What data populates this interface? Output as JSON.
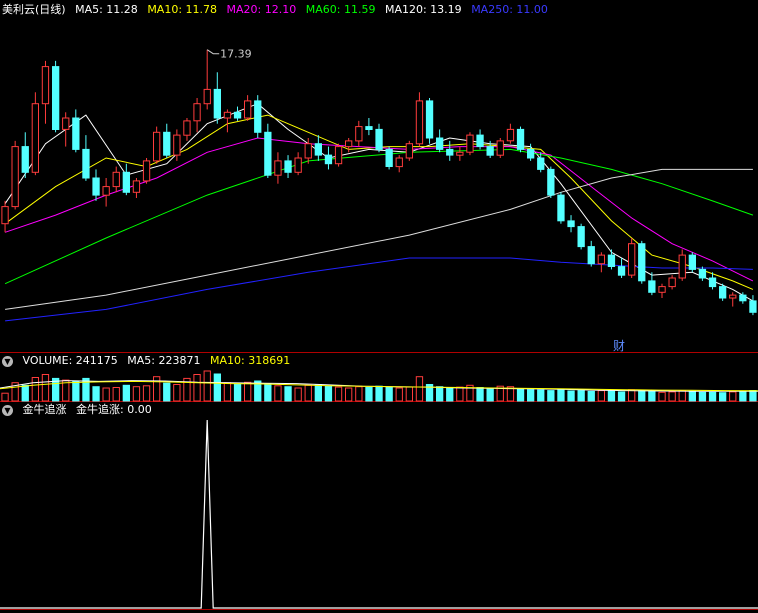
{
  "colors": {
    "up": "#ff3c3c",
    "down": "#54ffff",
    "panel_line": "#b00000",
    "ma5": "#ffffff",
    "ma10": "#ffff00",
    "ma20": "#ff00ff",
    "ma60": "#00ff00",
    "ma120": "#dddddd",
    "ma250": "#2222ff",
    "indicator": "#ffffff"
  },
  "main_header": {
    "title": "美利云(日线)",
    "ma5_label": "MA5: 11.28",
    "ma10_label": "MA10: 11.78",
    "ma20_label": "MA20: 12.10",
    "ma60_label": "MA60: 11.59",
    "ma120_label": "MA120: 13.19",
    "ma250_label": "MA250: 11.00"
  },
  "volume_header": {
    "label": "VOLUME: 241175",
    "ma5_label": "MA5: 223871",
    "ma10_label": "MA10: 318691"
  },
  "indicator_header": {
    "name": "金牛追涨",
    "value_label": "金牛追涨: 0.00"
  },
  "annotations": {
    "high_label": "17.39",
    "finance_marker": "财"
  },
  "chart_data": [
    {
      "type": "candlestick",
      "name": "price",
      "high_marker": 17.39,
      "y_range_estimate": [
        8.0,
        18.5
      ],
      "candles": [
        [
          11.3,
          12.1,
          11.0,
          11.9
        ],
        [
          11.9,
          14.2,
          11.8,
          14.0
        ],
        [
          14.0,
          14.5,
          12.9,
          13.1
        ],
        [
          13.1,
          15.9,
          13.0,
          15.5
        ],
        [
          15.5,
          17.0,
          14.8,
          16.8
        ],
        [
          16.8,
          17.0,
          14.5,
          14.6
        ],
        [
          14.6,
          15.2,
          14.0,
          15.0
        ],
        [
          15.0,
          15.3,
          13.8,
          13.9
        ],
        [
          13.9,
          14.4,
          12.8,
          12.9
        ],
        [
          12.9,
          13.2,
          12.1,
          12.3
        ],
        [
          12.3,
          12.9,
          11.9,
          12.6
        ],
        [
          12.6,
          13.3,
          12.4,
          13.1
        ],
        [
          13.1,
          13.4,
          12.3,
          12.4
        ],
        [
          12.4,
          12.9,
          12.2,
          12.8
        ],
        [
          12.8,
          13.6,
          12.7,
          13.5
        ],
        [
          13.5,
          14.7,
          13.4,
          14.5
        ],
        [
          14.5,
          14.8,
          13.6,
          13.7
        ],
        [
          13.7,
          14.6,
          13.5,
          14.4
        ],
        [
          14.4,
          15.0,
          14.2,
          14.9
        ],
        [
          14.9,
          15.7,
          14.5,
          15.5
        ],
        [
          15.5,
          17.39,
          15.3,
          16.0
        ],
        [
          16.0,
          16.6,
          14.8,
          15.0
        ],
        [
          15.0,
          15.3,
          14.5,
          15.2
        ],
        [
          15.2,
          15.4,
          14.9,
          15.0
        ],
        [
          15.0,
          15.8,
          14.9,
          15.6
        ],
        [
          15.6,
          15.8,
          14.3,
          14.5
        ],
        [
          14.5,
          14.8,
          12.9,
          13.0
        ],
        [
          13.0,
          13.8,
          12.7,
          13.5
        ],
        [
          13.5,
          13.7,
          12.9,
          13.1
        ],
        [
          13.1,
          13.8,
          13.0,
          13.6
        ],
        [
          13.6,
          14.3,
          13.4,
          14.1
        ],
        [
          14.1,
          14.4,
          13.5,
          13.7
        ],
        [
          13.7,
          14.0,
          13.2,
          13.4
        ],
        [
          13.4,
          14.1,
          13.3,
          14.0
        ],
        [
          14.0,
          14.3,
          13.8,
          14.2
        ],
        [
          14.2,
          14.9,
          14.0,
          14.7
        ],
        [
          14.7,
          15.0,
          14.4,
          14.6
        ],
        [
          14.6,
          14.8,
          13.8,
          13.9
        ],
        [
          13.9,
          14.0,
          13.2,
          13.3
        ],
        [
          13.3,
          13.7,
          13.1,
          13.6
        ],
        [
          13.6,
          14.2,
          13.5,
          14.1
        ],
        [
          14.1,
          15.9,
          14.0,
          15.6
        ],
        [
          15.6,
          15.7,
          14.1,
          14.3
        ],
        [
          14.3,
          14.6,
          13.8,
          13.9
        ],
        [
          13.9,
          14.2,
          13.5,
          13.7
        ],
        [
          13.7,
          14.0,
          13.5,
          13.8
        ],
        [
          13.8,
          14.5,
          13.7,
          14.4
        ],
        [
          14.4,
          14.6,
          13.9,
          14.0
        ],
        [
          14.0,
          14.2,
          13.6,
          13.7
        ],
        [
          13.7,
          14.3,
          13.6,
          14.2
        ],
        [
          14.2,
          14.8,
          14.1,
          14.6
        ],
        [
          14.6,
          14.7,
          13.8,
          13.9
        ],
        [
          13.9,
          14.1,
          13.5,
          13.6
        ],
        [
          13.6,
          13.8,
          13.1,
          13.2
        ],
        [
          13.2,
          13.3,
          12.2,
          12.3
        ],
        [
          12.3,
          12.4,
          11.3,
          11.4
        ],
        [
          11.4,
          11.6,
          11.0,
          11.2
        ],
        [
          11.2,
          11.3,
          10.4,
          10.5
        ],
        [
          10.5,
          10.7,
          9.8,
          9.9
        ],
        [
          9.9,
          10.3,
          9.6,
          10.2
        ],
        [
          10.2,
          10.4,
          9.7,
          9.8
        ],
        [
          9.8,
          10.1,
          9.4,
          9.5
        ],
        [
          9.5,
          10.8,
          9.4,
          10.6
        ],
        [
          10.6,
          10.7,
          9.2,
          9.3
        ],
        [
          9.3,
          9.6,
          8.8,
          8.9
        ],
        [
          8.9,
          9.2,
          8.7,
          9.1
        ],
        [
          9.1,
          9.5,
          9.0,
          9.4
        ],
        [
          9.4,
          10.4,
          9.3,
          10.2
        ],
        [
          10.2,
          10.3,
          9.6,
          9.7
        ],
        [
          9.7,
          9.8,
          9.3,
          9.4
        ],
        [
          9.4,
          9.6,
          9.0,
          9.1
        ],
        [
          9.1,
          9.2,
          8.6,
          8.7
        ],
        [
          8.7,
          8.9,
          8.4,
          8.8
        ],
        [
          8.8,
          8.9,
          8.5,
          8.6
        ],
        [
          8.6,
          8.8,
          8.1,
          8.2
        ]
      ],
      "moving_averages": [
        {
          "name": "MA5",
          "color": "#ffffff",
          "points": [
            [
              0,
              12.0
            ],
            [
              4,
              14.1
            ],
            [
              8,
              15.1
            ],
            [
              12,
              13.0
            ],
            [
              16,
              13.4
            ],
            [
              20,
              14.8
            ],
            [
              25,
              15.5
            ],
            [
              28,
              14.6
            ],
            [
              32,
              13.6
            ],
            [
              36,
              13.9
            ],
            [
              40,
              13.8
            ],
            [
              44,
              14.3
            ],
            [
              48,
              14.1
            ],
            [
              52,
              14.0
            ],
            [
              55,
              12.7
            ],
            [
              60,
              10.3
            ],
            [
              64,
              9.5
            ],
            [
              68,
              9.6
            ],
            [
              72,
              9.0
            ],
            [
              74,
              8.6
            ]
          ]
        },
        {
          "name": "MA10",
          "color": "#ffff00",
          "points": [
            [
              0,
              11.3
            ],
            [
              5,
              12.6
            ],
            [
              10,
              13.6
            ],
            [
              14,
              13.3
            ],
            [
              18,
              13.9
            ],
            [
              22,
              14.8
            ],
            [
              26,
              15.1
            ],
            [
              30,
              14.5
            ],
            [
              34,
              13.9
            ],
            [
              38,
              14.0
            ],
            [
              42,
              14.0
            ],
            [
              46,
              14.1
            ],
            [
              50,
              14.0
            ],
            [
              53,
              13.9
            ],
            [
              56,
              12.9
            ],
            [
              60,
              11.4
            ],
            [
              64,
              10.2
            ],
            [
              68,
              9.8
            ],
            [
              72,
              9.3
            ],
            [
              74,
              9.0
            ]
          ]
        },
        {
          "name": "MA20",
          "color": "#ff00ff",
          "points": [
            [
              0,
              11.0
            ],
            [
              5,
              11.6
            ],
            [
              10,
              12.3
            ],
            [
              15,
              12.9
            ],
            [
              20,
              13.8
            ],
            [
              25,
              14.3
            ],
            [
              30,
              14.1
            ],
            [
              35,
              14.0
            ],
            [
              40,
              13.9
            ],
            [
              45,
              14.0
            ],
            [
              50,
              14.0
            ],
            [
              54,
              13.7
            ],
            [
              58,
              12.6
            ],
            [
              62,
              11.5
            ],
            [
              66,
              10.6
            ],
            [
              70,
              10.0
            ],
            [
              74,
              9.3
            ]
          ]
        },
        {
          "name": "MA60",
          "color": "#00ff00",
          "points": [
            [
              0,
              9.2
            ],
            [
              10,
              10.8
            ],
            [
              20,
              12.3
            ],
            [
              30,
              13.5
            ],
            [
              40,
              13.8
            ],
            [
              50,
              13.9
            ],
            [
              55,
              13.6
            ],
            [
              60,
              13.2
            ],
            [
              65,
              12.7
            ],
            [
              70,
              12.1
            ],
            [
              74,
              11.6
            ]
          ]
        },
        {
          "name": "MA120",
          "color": "#dddddd",
          "points": [
            [
              0,
              8.3
            ],
            [
              10,
              8.8
            ],
            [
              20,
              9.5
            ],
            [
              30,
              10.2
            ],
            [
              40,
              10.9
            ],
            [
              50,
              11.8
            ],
            [
              55,
              12.4
            ],
            [
              60,
              12.9
            ],
            [
              65,
              13.2
            ],
            [
              70,
              13.2
            ],
            [
              74,
              13.2
            ]
          ]
        },
        {
          "name": "MA250",
          "color": "#2222ff",
          "points": [
            [
              0,
              7.9
            ],
            [
              10,
              8.3
            ],
            [
              20,
              9.0
            ],
            [
              30,
              9.6
            ],
            [
              40,
              10.1
            ],
            [
              50,
              10.1
            ],
            [
              55,
              9.95
            ],
            [
              60,
              9.85
            ],
            [
              65,
              9.75
            ],
            [
              70,
              9.75
            ],
            [
              74,
              9.7
            ]
          ]
        }
      ]
    },
    {
      "type": "bar",
      "name": "volume",
      "values": [
        180000,
        420000,
        360000,
        540000,
        610000,
        520000,
        480000,
        450000,
        520000,
        330000,
        300000,
        310000,
        360000,
        330000,
        350000,
        560000,
        410000,
        380000,
        520000,
        610000,
        690000,
        620000,
        420000,
        380000,
        430000,
        460000,
        390000,
        350000,
        330000,
        300000,
        360000,
        380000,
        340000,
        320000,
        300000,
        330000,
        310000,
        340000,
        320000,
        300000,
        320000,
        560000,
        380000,
        330000,
        300000,
        320000,
        360000,
        310000,
        300000,
        340000,
        330000,
        270000,
        260000,
        250000,
        240000,
        260000,
        230000,
        240000,
        220000,
        240000,
        230000,
        210000,
        260000,
        250000,
        220000,
        200000,
        210000,
        240000,
        220000,
        200000,
        200000,
        190000,
        210000,
        220000,
        241175
      ],
      "ma5": [
        300000,
        420000,
        470000,
        450000,
        470000,
        460000,
        430000,
        420000,
        410000,
        400000,
        370000,
        340000,
        330000,
        320000,
        300000,
        290000,
        280000,
        270000,
        250000,
        240000,
        230000,
        225000,
        224000,
        224000
      ],
      "ma10": [
        280000,
        360000,
        420000,
        440000,
        450000,
        440000,
        420000,
        400000,
        390000,
        370000,
        350000,
        340000,
        330000,
        320000,
        310000,
        300000,
        290000,
        280000,
        270000,
        260000,
        250000,
        245000,
        240000,
        238000
      ]
    },
    {
      "type": "line",
      "name": "金牛追涨",
      "spike_index": 20,
      "spike_value": 1,
      "value": 0
    }
  ]
}
